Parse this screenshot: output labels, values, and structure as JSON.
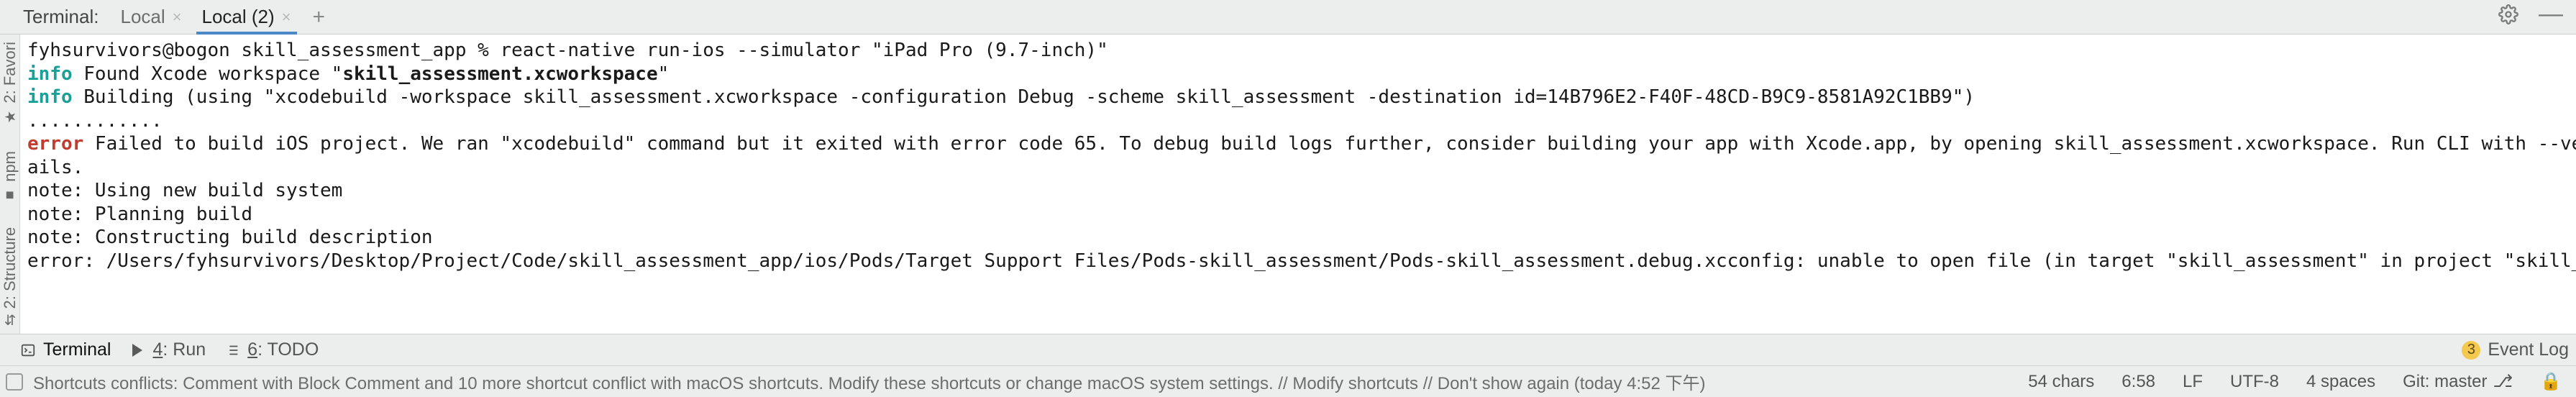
{
  "topbar": {
    "title": "Terminal:",
    "tabs": [
      {
        "label": "Local",
        "active": false
      },
      {
        "label": "Local (2)",
        "active": true
      }
    ],
    "add_tab": "+"
  },
  "left_gutter": {
    "favorites": {
      "label": "2: Favori",
      "icon": "★"
    },
    "npm": {
      "label": "npm",
      "icon": "■"
    },
    "structure": {
      "label": "2: Structure",
      "icon": "⇵"
    }
  },
  "console": {
    "prompt": "fyhsurvivors@bogon skill_assessment_app % react-native run-ios --simulator \"iPad Pro (9.7-inch)\"",
    "line_info_found_prefix": "info",
    "line_info_found_a": " Found Xcode workspace \"",
    "line_info_found_b": "skill_assessment.xcworkspace",
    "line_info_found_c": "\"",
    "line_build_prefix": "info",
    "line_build_rest": " Building (using \"xcodebuild -workspace skill_assessment.xcworkspace -configuration Debug -scheme skill_assessment -destination id=14B796E2-F40F-48CD-B9C9-8581A92C1BB9\")",
    "dots": "............",
    "line_error_prefix": "error",
    "line_error_rest": " Failed to build iOS project. We ran \"xcodebuild\" command but it exited with error code 65. To debug build logs further, consider building your app with Xcode.app, by opening skill_assessment.xcworkspace. Run CLI with --verbose flag for more det",
    "line_error_wrap": "ails.",
    "note1": "note: Using new build system",
    "note2": "note: Planning build",
    "note3": "note: Constructing build description",
    "line_err2": "error: /Users/fyhsurvivors/Desktop/Project/Code/skill_assessment_app/ios/Pods/Target Support Files/Pods-skill_assessment/Pods-skill_assessment.debug.xcconfig: unable to open file (in target \"skill_assessment\" in project \"skill_assessment\") (in target"
  },
  "lowbar": {
    "terminal": "Terminal",
    "run_num": "4",
    "run_label": ": Run",
    "todo_num": "6",
    "todo_label": ": TODO",
    "event_log": "Event Log",
    "event_badge": "3"
  },
  "status": {
    "message": "Shortcuts conflicts: Comment with Block Comment and 10 more shortcut conflict with macOS shortcuts. Modify these shortcuts or change macOS system settings. // Modify shortcuts // Don't show again (today 4:52 下午)",
    "chars": "54 chars",
    "time": "6:58",
    "line_sep": "LF",
    "encoding": "UTF-8",
    "indent": "4 spaces",
    "git": "Git: master",
    "git_branch_icon": "⎇",
    "lock_icon": "🔒"
  }
}
